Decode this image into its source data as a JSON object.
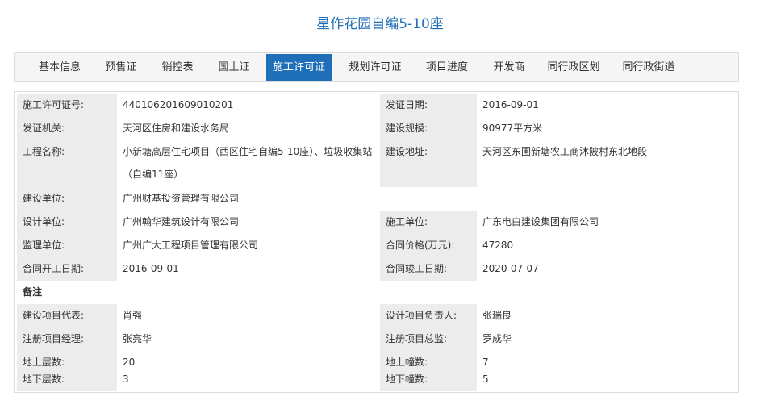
{
  "page": {
    "title": "星作花园自编5-10座"
  },
  "tabs": [
    {
      "label": "基本信息",
      "active": false
    },
    {
      "label": "预售证",
      "active": false
    },
    {
      "label": "销控表",
      "active": false
    },
    {
      "label": "国土证",
      "active": false
    },
    {
      "label": "施工许可证",
      "active": true
    },
    {
      "label": "规划许可证",
      "active": false
    },
    {
      "label": "项目进度",
      "active": false
    },
    {
      "label": "开发商",
      "active": false
    },
    {
      "label": "同行政区划",
      "active": false
    },
    {
      "label": "同行政街道",
      "active": false
    }
  ],
  "permit": {
    "permit_no_label": "施工许可证号:",
    "permit_no": "440106201609010201",
    "issue_date_label": "发证日期:",
    "issue_date": "2016-09-01",
    "issuer_label": "发证机关:",
    "issuer": "天河区住房和建设水务局",
    "scale_label": "建设规模:",
    "scale": "90977平方米",
    "project_name_label": "工程名称:",
    "project_name": "小新塘高层住宅项目（西区住宅自编5-10座）、垃圾收集站（自编11座）",
    "address_label": "建设地址:",
    "address": "天河区东圃新塘农工商沐陂村东北地段",
    "builder_label": "建设单位:",
    "builder": "广州财基投资管理有限公司",
    "designer_label": "设计单位:",
    "designer": "广州翰华建筑设计有限公司",
    "contractor_label": "施工单位:",
    "contractor": "广东电白建设集团有限公司",
    "supervisor_label": "监理单位:",
    "supervisor": "广州广大工程项目管理有限公司",
    "contract_price_label": "合同价格(万元):",
    "contract_price": "47280",
    "start_date_label": "合同开工日期:",
    "start_date": "2016-09-01",
    "finish_date_label": "合同竣工日期:",
    "finish_date": "2020-07-07",
    "remarks_label": "备注",
    "rep_label": "建设项目代表:",
    "rep": "肖强",
    "design_lead_label": "设计项目负责人:",
    "design_lead": "张瑞良",
    "pm_label": "注册项目经理:",
    "pm": "张亮华",
    "chief_supervisor_label": "注册项目总监:",
    "chief_supervisor": "罗成华",
    "floors_above_label": "地上层数:",
    "floors_above": "20",
    "buildings_above_label": "地上幢数:",
    "buildings_above": "7",
    "floors_below_label": "地下层数:",
    "floors_below": "3",
    "buildings_below_label": "地下幢数:",
    "buildings_below": "5"
  }
}
